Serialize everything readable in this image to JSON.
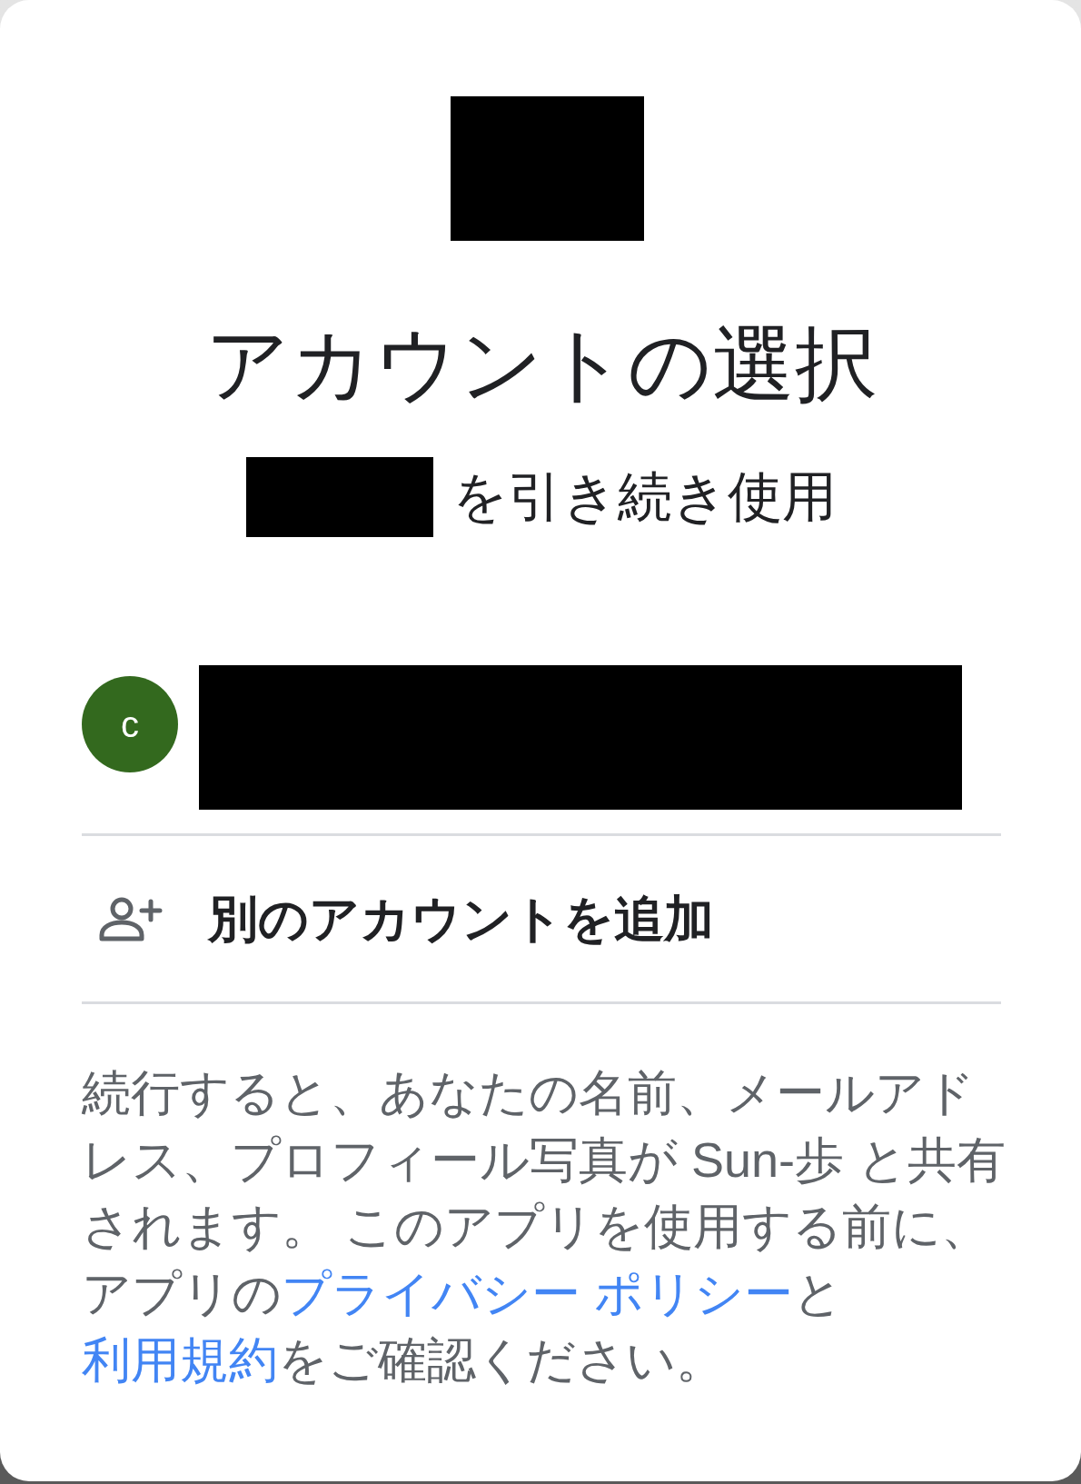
{
  "title": "アカウントの選択",
  "subtitle": "を引き続き使用",
  "accounts": [
    {
      "initial": "c",
      "color": "#33691e"
    }
  ],
  "add_account": {
    "label": "別のアカウントを追加"
  },
  "disclosure": {
    "parts": [
      {
        "kind": "text",
        "text": "続行すると、あなたの名前、メールアドレス、プロフィール写真が Sun-歩 と共有されます。 このアプリを使用する前に、アプリの"
      },
      {
        "kind": "link",
        "text": "プライバシー ポリシー"
      },
      {
        "kind": "text",
        "text": "と"
      },
      {
        "kind": "link",
        "text": "利用規約"
      },
      {
        "kind": "text",
        "text": "をご確認ください。"
      }
    ]
  }
}
